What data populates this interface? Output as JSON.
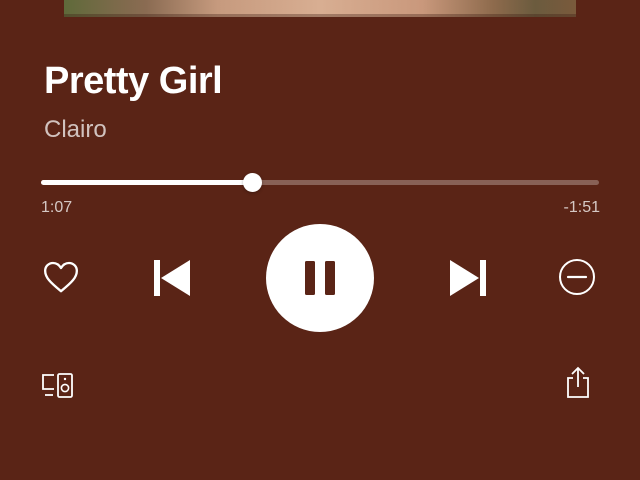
{
  "track": {
    "title": "Pretty Girl",
    "artist": "Clairo"
  },
  "playback": {
    "elapsed": "1:07",
    "remaining": "-1:51",
    "progress_fraction": 0.38,
    "state": "playing"
  },
  "icons": {
    "like": "heart-outline-icon",
    "previous": "skip-previous-icon",
    "pause": "pause-icon",
    "next": "skip-next-icon",
    "hide": "minus-circle-icon",
    "devices": "connect-devices-icon",
    "share": "share-icon"
  },
  "colors": {
    "background": "#5a2416",
    "foreground": "#ffffff",
    "track_inactive": "rgba(255,255,255,0.28)"
  }
}
